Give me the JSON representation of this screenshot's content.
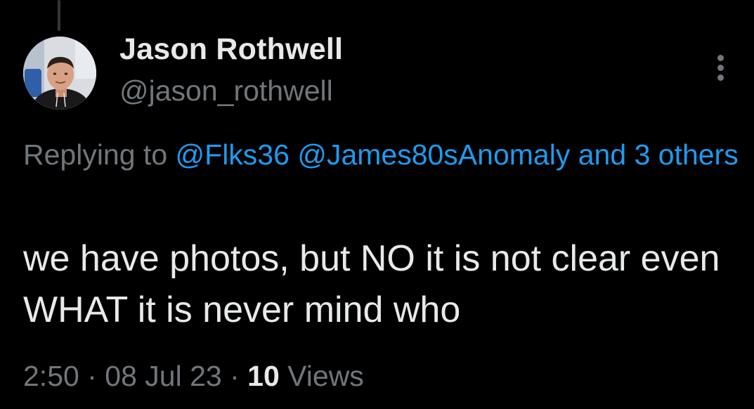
{
  "author": {
    "display_name": "Jason Rothwell",
    "handle": "@jason_rothwell"
  },
  "reply_context": {
    "prefix": "Replying to",
    "mentions": [
      "@Flks36",
      "@James80sAnomaly"
    ],
    "connector": "and",
    "others": "3 others"
  },
  "tweet": {
    "text": "we have photos, but NO it is not clear even WHAT it is never mind who"
  },
  "meta": {
    "time": "2:50",
    "separator": "·",
    "date": "08 Jul 23",
    "views_count": "10",
    "views_label": "Views"
  },
  "icons": {
    "more": "more-vertical-icon"
  },
  "colors": {
    "background": "#000000",
    "primary_text": "#e7e9ea",
    "secondary_text": "#71767b",
    "accent": "#1d9bf0"
  }
}
